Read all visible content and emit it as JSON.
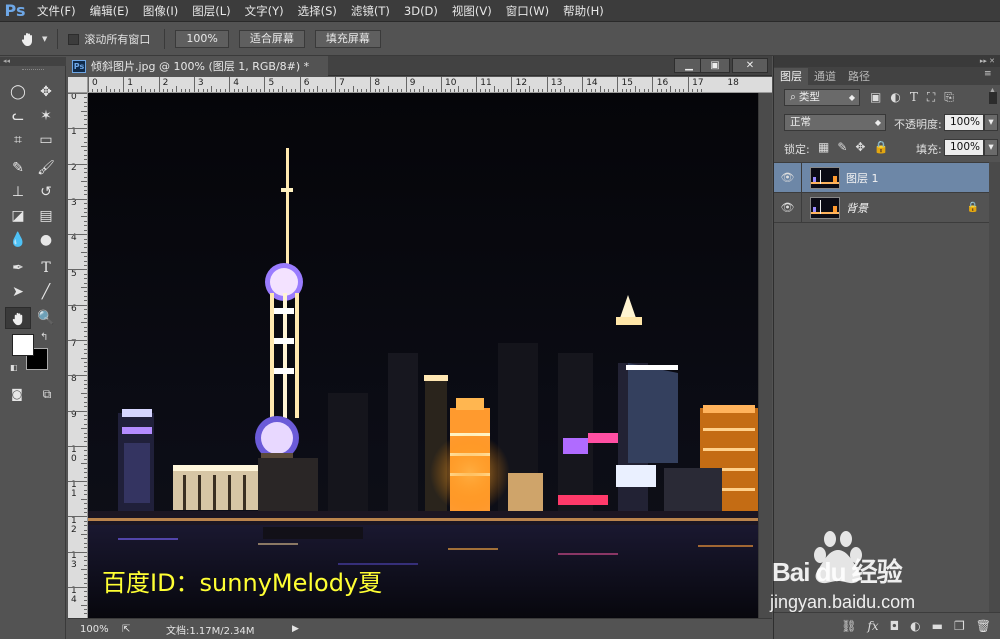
{
  "app": {
    "logo": "Ps"
  },
  "menu": [
    "文件(F)",
    "编辑(E)",
    "图像(I)",
    "图层(L)",
    "文字(Y)",
    "选择(S)",
    "滤镜(T)",
    "3D(D)",
    "视图(V)",
    "窗口(W)",
    "帮助(H)"
  ],
  "options": {
    "scroll_all_label": "滚动所有窗口",
    "zoom100": "100%",
    "fit_screen": "适合屏幕",
    "fill_screen": "填充屏幕"
  },
  "document": {
    "tab_title": "倾斜图片.jpg @ 100% (图层 1, RGB/8#) *",
    "ruler_top": [
      "0",
      "1",
      "2",
      "3",
      "4",
      "5",
      "6",
      "7",
      "8",
      "9",
      "10",
      "11",
      "12",
      "13",
      "14",
      "15",
      "16",
      "17",
      "18"
    ],
    "ruler_left": [
      "0",
      "1",
      "2",
      "3",
      "4",
      "5",
      "6",
      "7",
      "8",
      "9",
      "1\n0",
      "1\n1",
      "1\n2",
      "1\n3",
      "1\n4"
    ],
    "watermark_text": "百度ID：sunnyMelody夏",
    "watermark_color": "#ffff33",
    "status_zoom": "100%",
    "status_doc": "文档:1.17M/2.34M"
  },
  "panel": {
    "tabs": [
      "图层",
      "通道",
      "路径"
    ],
    "filter_kind": "类型",
    "blend_mode": "正常",
    "opacity_label": "不透明度:",
    "opacity_value": "100%",
    "lock_label": "锁定:",
    "fill_label": "填充:",
    "fill_value": "100%",
    "layers": [
      {
        "name": "图层 1",
        "selected": true,
        "locked": false
      },
      {
        "name": "背景",
        "selected": false,
        "locked": true
      }
    ]
  },
  "baidu": {
    "brand": "Bai du 经验",
    "url": "jingyan.baidu.com"
  },
  "colors": {
    "menubar": "#3c3c3c",
    "panel": "#535353",
    "selected_layer": "#6d87a7",
    "ps_blue": "#6ea7e6"
  }
}
